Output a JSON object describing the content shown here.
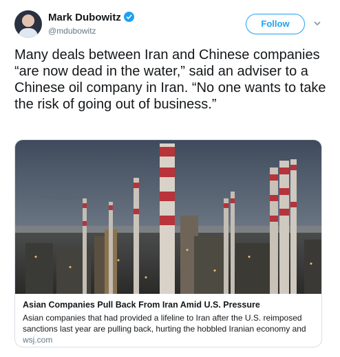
{
  "author": {
    "name": "Mark Dubowitz",
    "handle": "@mdubowitz",
    "verified": true,
    "verified_icon": "verified-badge-icon"
  },
  "follow_label": "Follow",
  "menu_icon": "chevron-down-icon",
  "tweet": {
    "text": "Many deals between Iran and Chinese companies “are now dead in the water,” said an adviser to a Chinese oil company in Iran. “No one wants to take the risk of going out of business.”"
  },
  "card": {
    "image_description_icon": "refinery-photo",
    "title": "Asian Companies Pull Back From Iran Amid U.S. Pressure",
    "description": "Asian companies that had provided a lifeline to Iran after the U.S. reimposed sanctions last year are pulling back, hurting the hobbled Iranian economy and le...",
    "domain": "wsj.com"
  },
  "colors": {
    "accent": "#1da1f2",
    "text": "#14171a",
    "muted": "#657786"
  }
}
